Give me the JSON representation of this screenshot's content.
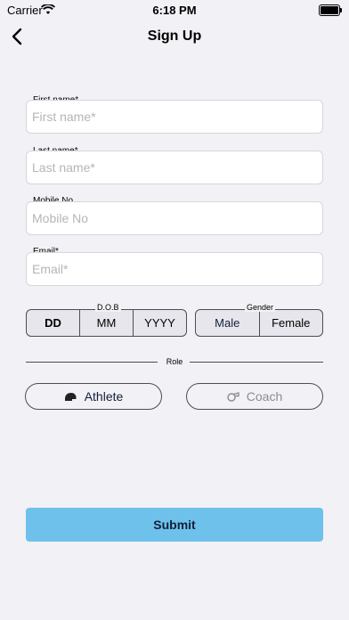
{
  "status_bar": {
    "carrier": "Carrier",
    "time": "6:18 PM"
  },
  "nav": {
    "title": "Sign Up"
  },
  "form": {
    "first_name": {
      "label": "First name*",
      "placeholder": "First name*"
    },
    "last_name": {
      "label": "Last name*",
      "placeholder": "Last name*"
    },
    "mobile": {
      "label": "Mobile No",
      "placeholder": "Mobile No"
    },
    "email": {
      "label": "Email*",
      "placeholder": "Email*"
    },
    "dob": {
      "label": "D.O.B",
      "day": "DD",
      "month": "MM",
      "year": "YYYY"
    },
    "gender": {
      "label": "Gender",
      "male": "Male",
      "female": "Female"
    },
    "role": {
      "label": "Role",
      "athlete": "Athlete",
      "coach": "Coach"
    },
    "submit": "Submit"
  },
  "colors": {
    "submit_bg": "#6ec1ea",
    "background": "#f2f1f6",
    "coach_text": "#8e8c90"
  },
  "icons": {
    "back": "chevron-left-icon",
    "athlete": "helmet-icon",
    "coach": "whistle-icon"
  }
}
